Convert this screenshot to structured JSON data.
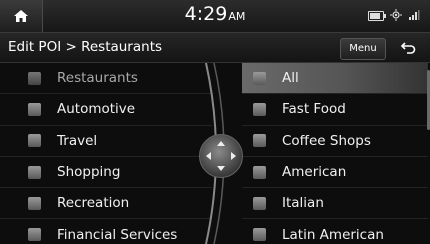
{
  "status": {
    "time": "4:29",
    "ampm": "AM"
  },
  "header": {
    "title": "Edit POI > Restaurants",
    "menu_label": "Menu"
  },
  "categories": [
    {
      "label": "Restaurants",
      "icon": "restaurant-icon",
      "active": true
    },
    {
      "label": "Automotive",
      "icon": "car-icon",
      "active": false
    },
    {
      "label": "Travel",
      "icon": "suitcase-icon",
      "active": false
    },
    {
      "label": "Shopping",
      "icon": "shopping-bag-icon",
      "active": false
    },
    {
      "label": "Recreation",
      "icon": "recreation-icon",
      "active": false
    },
    {
      "label": "Financial Services",
      "icon": "dollar-icon",
      "active": false
    }
  ],
  "subcategories": [
    {
      "label": "All",
      "icon": "restaurant-icon",
      "selected": true
    },
    {
      "label": "Fast Food",
      "icon": "fast-food-icon",
      "selected": false
    },
    {
      "label": "Coffee Shops",
      "icon": "coffee-icon",
      "selected": false
    },
    {
      "label": "American",
      "icon": "american-food-icon",
      "selected": false
    },
    {
      "label": "Italian",
      "icon": "italian-food-icon",
      "selected": false
    },
    {
      "label": "Latin American",
      "icon": "latin-food-icon",
      "selected": false
    }
  ]
}
